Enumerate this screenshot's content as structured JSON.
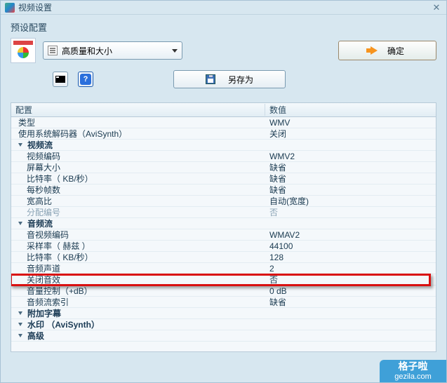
{
  "window": {
    "title": "视频设置"
  },
  "preset": {
    "label": "预设配置",
    "selected": "高质量和大小"
  },
  "buttons": {
    "ok": "确定",
    "saveas": "另存为",
    "help_glyph": "?"
  },
  "grid": {
    "header_config": "配置",
    "header_value": "数值",
    "rows": [
      {
        "label": "类型",
        "value": "WMV",
        "indent": 0
      },
      {
        "label": "使用系统解码器（AviSynth）",
        "value": "关闭",
        "indent": 0
      },
      {
        "label": "视频流",
        "value": "",
        "indent": 0,
        "group": true
      },
      {
        "label": "视频编码",
        "value": "WMV2",
        "indent": 1
      },
      {
        "label": "屏幕大小",
        "value": "缺省",
        "indent": 1
      },
      {
        "label": "比特率（ KB/秒）",
        "value": "缺省",
        "indent": 1
      },
      {
        "label": "每秒帧数",
        "value": "缺省",
        "indent": 1
      },
      {
        "label": "宽高比",
        "value": "自动(宽度)",
        "indent": 1
      },
      {
        "label": "分配编号",
        "value": "否",
        "indent": 1,
        "ghost": true
      },
      {
        "label": "音频流",
        "value": "",
        "indent": 0,
        "group": true
      },
      {
        "label": "音视频编码",
        "value": "WMAV2",
        "indent": 1
      },
      {
        "label": "采样率（ 赫兹 ）",
        "value": "44100",
        "indent": 1
      },
      {
        "label": "比特率（ KB/秒）",
        "value": "128",
        "indent": 1
      },
      {
        "label": "音频声道",
        "value": "2",
        "indent": 1
      },
      {
        "label": "关闭音效",
        "value": "否",
        "indent": 1,
        "highlight": true
      },
      {
        "label": "音量控制（+dB）",
        "value": "0 dB",
        "indent": 1
      },
      {
        "label": "音频流索引",
        "value": "缺省",
        "indent": 1
      },
      {
        "label": "附加字幕",
        "value": "",
        "indent": 0,
        "group": true
      },
      {
        "label": "水印 （AviSynth）",
        "value": "",
        "indent": 0,
        "group": true
      },
      {
        "label": "高级",
        "value": "",
        "indent": 0,
        "group": true
      }
    ]
  },
  "watermark": {
    "line1": "格子啦",
    "line2": "gezila.com"
  }
}
